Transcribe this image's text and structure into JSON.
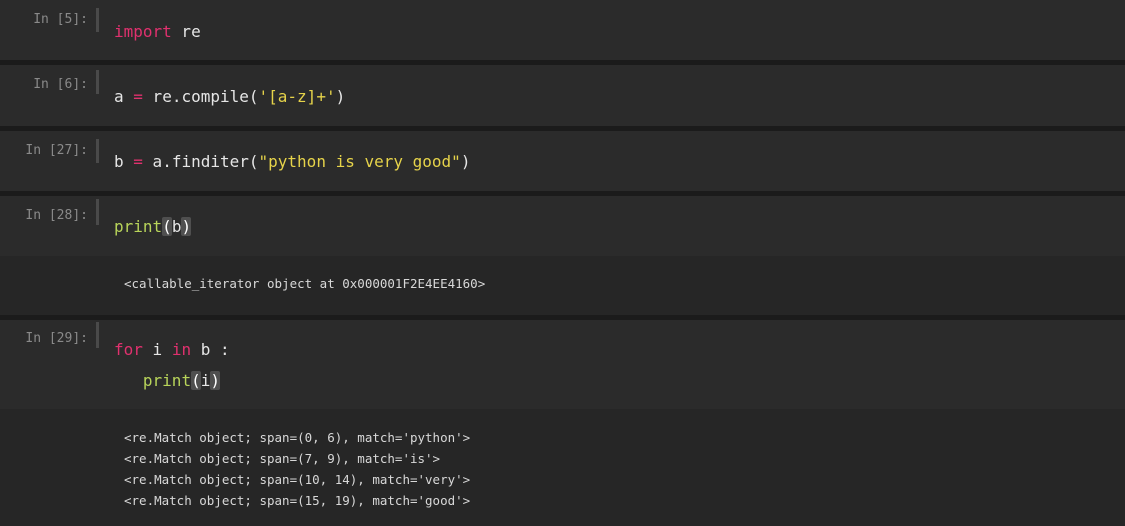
{
  "cells": [
    {
      "prompt": "In [5]:",
      "line1_kw": "import",
      "line1_rest": " re"
    },
    {
      "prompt": "In [6]:",
      "var": "a",
      "eq": "=",
      "call": " re.compile(",
      "str": "'[a-z]+'",
      "close": ")"
    },
    {
      "prompt": "In [27]:",
      "var": "b",
      "eq": "=",
      "call": " a.finditer(",
      "str": "\"python is very good\"",
      "close": ")"
    },
    {
      "prompt": "In [28]:",
      "fn": "print",
      "open": "(",
      "arg": "b",
      "close": ")",
      "output": "<callable_iterator object at 0x000001F2E4EE4160>"
    },
    {
      "prompt": "In [29]:",
      "kw_for": "for",
      "var_i": " i ",
      "kw_in": "in",
      "rest": " b :",
      "fn": "print",
      "open": "(",
      "arg": "i",
      "close": ")",
      "output": [
        "<re.Match object; span=(0, 6), match='python'>",
        "<re.Match object; span=(7, 9), match='is'>",
        "<re.Match object; span=(10, 14), match='very'>",
        "<re.Match object; span=(15, 19), match='good'>"
      ]
    }
  ],
  "colors": {
    "keyword": "#e0316e",
    "function": "#b8d45a",
    "string": "#e6d34a",
    "text": "#e6e6e6",
    "prompt": "#8a8a8a",
    "cell_bg": "#2b2b2b",
    "output_bg": "#262626"
  }
}
